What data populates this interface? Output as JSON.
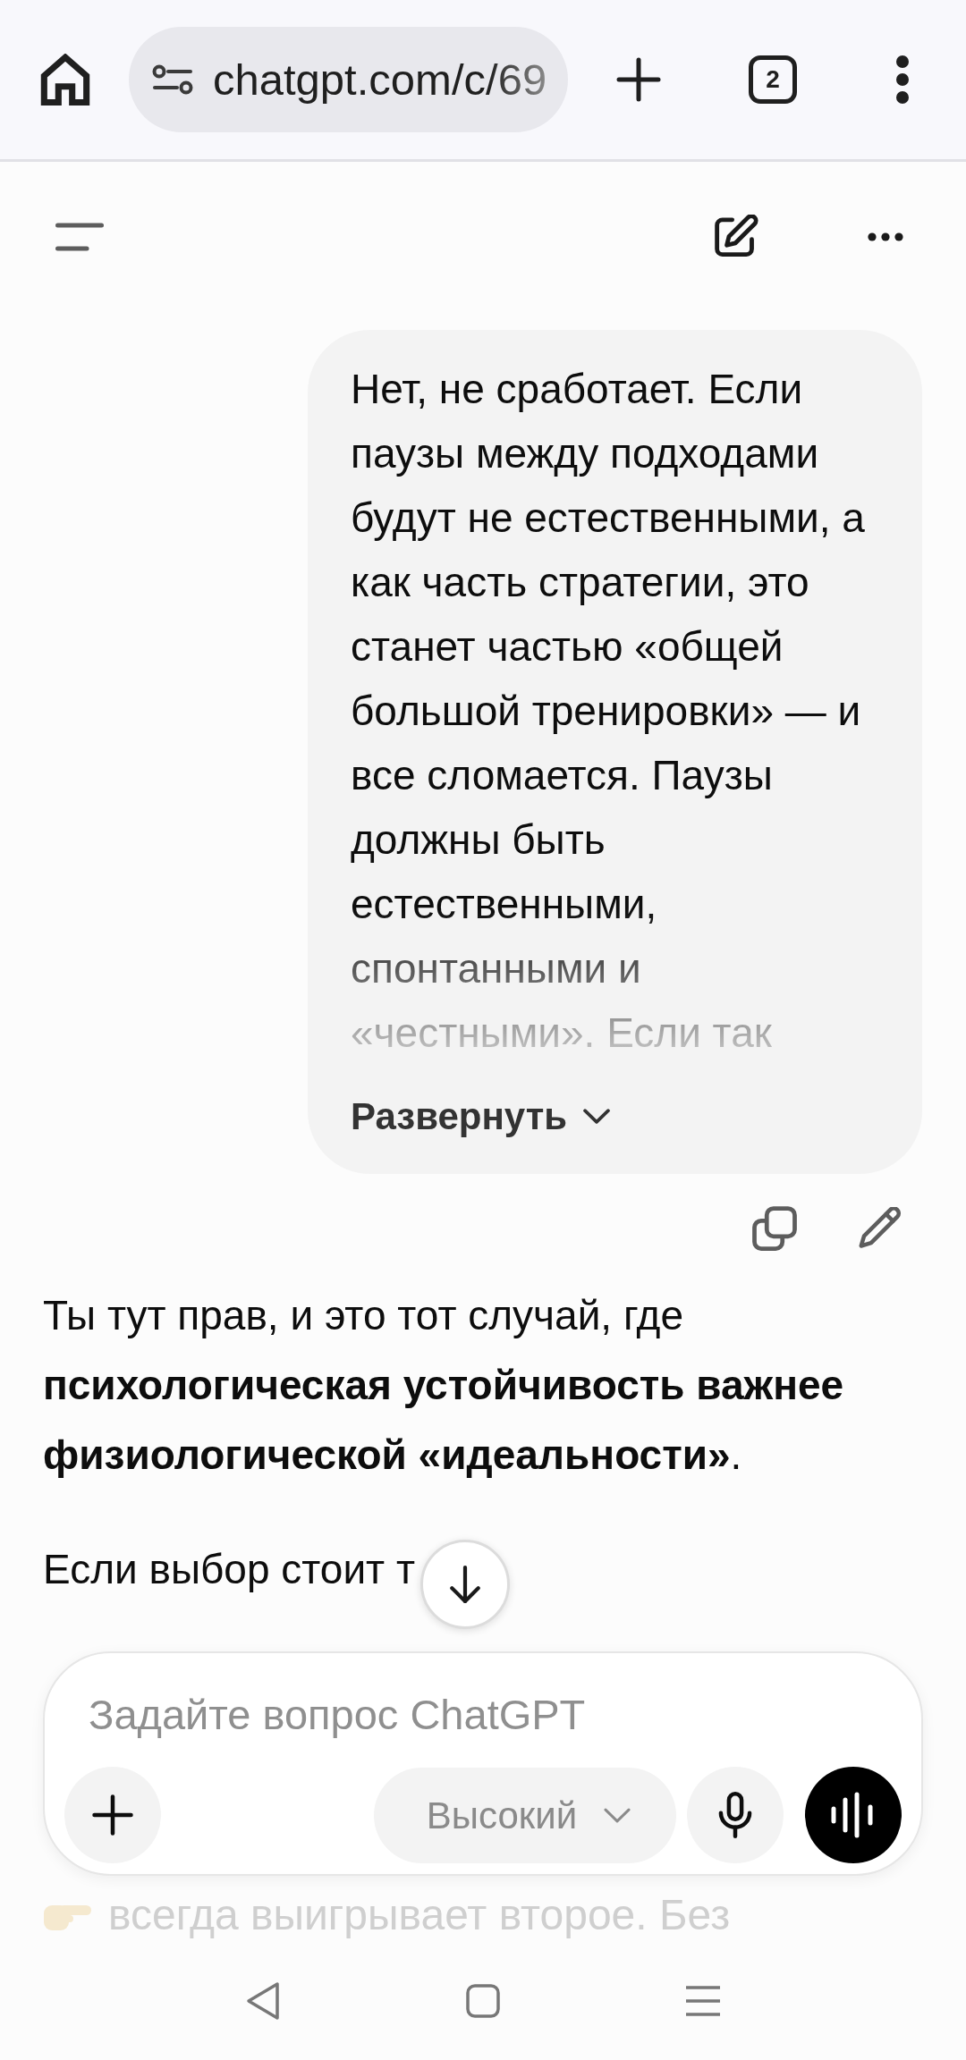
{
  "browser": {
    "url": "chatgpt.com/c/69",
    "tab_count": "2"
  },
  "messages": [
    {
      "kind": "user",
      "text": "Нет, не сработает. Если паузы между подходами будут не естественными, а как часть стратегии, это станет частью «общей большой тренировки» — и все сломается. Паузы должны быть естественными, спонтанными и «честными». Если так",
      "expand_label": "Развернуть"
    },
    {
      "kind": "assistant",
      "paragraphs": [
        "Ты тут прав, и это тот случай, где **психологическая устойчивость важнее физиологической «идеальности»**.",
        "Если выбор стоит т"
      ]
    }
  ],
  "composer": {
    "placeholder": "Задайте вопрос ChatGPT",
    "model_mode": "Высокий"
  },
  "background_text": "всегда выигрывает второе. Без"
}
